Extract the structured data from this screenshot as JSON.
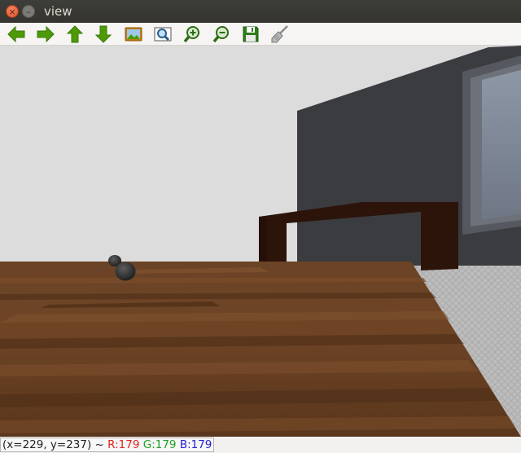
{
  "window": {
    "title": "view",
    "close_glyph": "×",
    "minimize_glyph": "–"
  },
  "toolbar": {
    "buttons": [
      {
        "name": "back",
        "icon": "arrow-left-icon"
      },
      {
        "name": "forward",
        "icon": "arrow-right-icon"
      },
      {
        "name": "up",
        "icon": "arrow-up-icon"
      },
      {
        "name": "down",
        "icon": "arrow-down-icon"
      },
      {
        "name": "image",
        "icon": "picture-icon"
      },
      {
        "name": "zoom-fit",
        "icon": "zoom-frame-icon"
      },
      {
        "name": "zoom-in",
        "icon": "zoom-in-icon"
      },
      {
        "name": "zoom-out",
        "icon": "zoom-out-icon"
      },
      {
        "name": "save",
        "icon": "floppy-disk-icon"
      },
      {
        "name": "clear",
        "icon": "broom-icon"
      }
    ],
    "colors": {
      "arrow": "#4e9a06",
      "arrow_dark": "#3b7a04"
    }
  },
  "status": {
    "coords": "(x=229, y=237) ~ ",
    "r": "R:179",
    "g": "G:179",
    "b": "B:179",
    "colors": {
      "r": "#e0241b",
      "g": "#20a020",
      "b": "#2222cc"
    }
  }
}
